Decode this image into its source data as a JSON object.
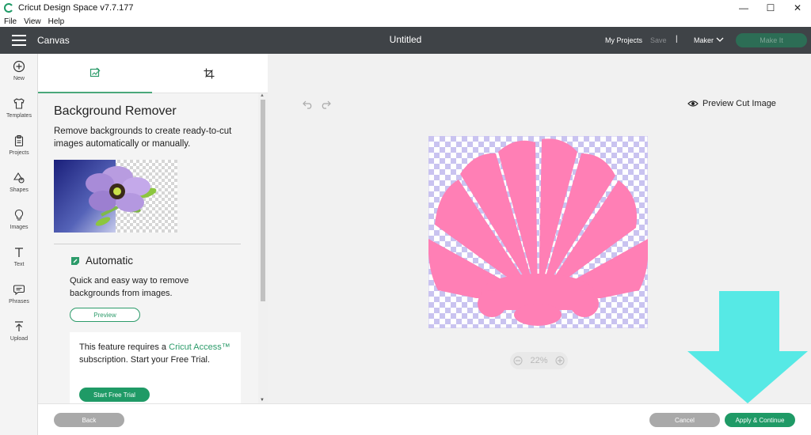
{
  "window": {
    "title": "Cricut Design Space  v7.7.177",
    "controls": {
      "minimize": "—",
      "maximize": "☐",
      "close": "✕"
    }
  },
  "menubar": {
    "items": [
      "File",
      "View",
      "Help"
    ]
  },
  "header": {
    "section": "Canvas",
    "title": "Untitled",
    "my_projects": "My Projects",
    "save": "Save",
    "separator": "|",
    "machine": "Maker",
    "make_it": "Make It"
  },
  "rail": {
    "items": [
      {
        "label": "New",
        "icon": "plus-circle-icon"
      },
      {
        "label": "Templates",
        "icon": "shirt-icon"
      },
      {
        "label": "Projects",
        "icon": "clipboard-icon"
      },
      {
        "label": "Shapes",
        "icon": "shapes-icon"
      },
      {
        "label": "Images",
        "icon": "lightbulb-icon"
      },
      {
        "label": "Text",
        "icon": "text-icon"
      },
      {
        "label": "Phrases",
        "icon": "speech-bubble-icon"
      },
      {
        "label": "Upload",
        "icon": "upload-icon"
      }
    ]
  },
  "panel": {
    "tabs": [
      {
        "icon": "eraser-image-icon",
        "active": true
      },
      {
        "icon": "crop-icon",
        "active": false
      }
    ],
    "title": "Background Remover",
    "description": "Remove backgrounds to create ready-to-cut images automatically or manually.",
    "automatic": {
      "title": "Automatic",
      "description": "Quick and easy way to remove backgrounds from images.",
      "preview_label": "Preview"
    },
    "access": {
      "text_before": "This feature requires a ",
      "link": "Cricut Access™",
      "text_after": " subscription. Start your Free Trial.",
      "trial_label": "Start Free Trial"
    }
  },
  "canvas": {
    "preview_cut_label": "Preview Cut Image",
    "zoom": "22%"
  },
  "footer": {
    "back_label": "Back",
    "cancel_label": "Cancel",
    "apply_label": "Apply & Continue"
  },
  "colors": {
    "header": "#3f4347",
    "accent": "#1f9a66",
    "shell": "#ff7fb5",
    "checker": "#c9c3f0",
    "annotation_arrow": "#56e9e5"
  }
}
